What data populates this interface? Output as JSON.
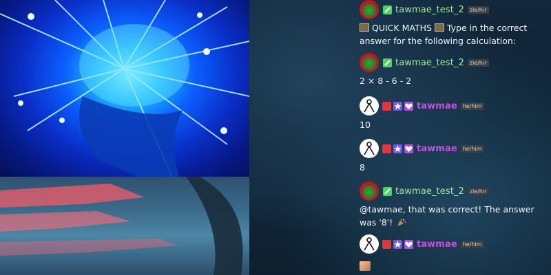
{
  "chat": {
    "messages": [
      {
        "username": "tawmae_test_2",
        "pronoun": "zie/hir",
        "text_parts": [
          "QUICK MATHS",
          "Type in the correct answer for the following calculation:"
        ]
      },
      {
        "username": "tawmae_test_2",
        "pronoun": "zie/hir",
        "text": "2 × 8 - 6 - 2"
      },
      {
        "username": "tawmae",
        "pronoun": "he/him",
        "text": "10"
      },
      {
        "username": "tawmae",
        "pronoun": "he/him",
        "text": "8"
      },
      {
        "username": "tawmae_test_2",
        "pronoun": "zie/hir",
        "text": "@tawmae, that was correct! The answer was '8'!"
      },
      {
        "username": "tawmae",
        "pronoun": "he/him",
        "text": ""
      }
    ]
  },
  "colors": {
    "bot_name": "#9be7a3",
    "user_name": "#c850e0",
    "pronoun_bg": "#3b3f44"
  },
  "icons": {
    "verified": "sword-badge-icon",
    "live": "camera-badge-icon",
    "star": "star-badge-icon",
    "heart": "heart-badge-icon",
    "quick_maths": "calculator-icon",
    "party": "party-emote-icon"
  }
}
